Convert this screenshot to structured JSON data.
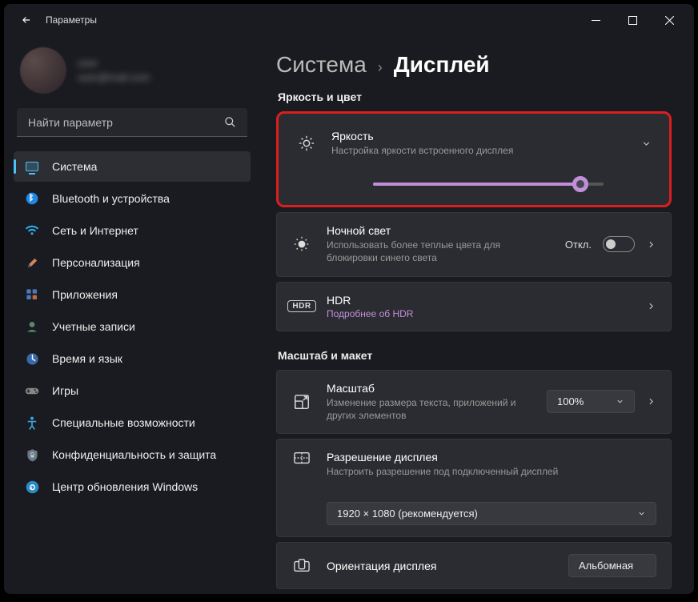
{
  "titlebar": {
    "title": "Параметры"
  },
  "profile": {
    "name": "user",
    "email": "user@mail.com"
  },
  "search": {
    "placeholder": "Найти параметр"
  },
  "sidebar": {
    "items": [
      {
        "label": "Система"
      },
      {
        "label": "Bluetooth и устройства"
      },
      {
        "label": "Сеть и Интернет"
      },
      {
        "label": "Персонализация"
      },
      {
        "label": "Приложения"
      },
      {
        "label": "Учетные записи"
      },
      {
        "label": "Время и язык"
      },
      {
        "label": "Игры"
      },
      {
        "label": "Специальные возможности"
      },
      {
        "label": "Конфиденциальность и защита"
      },
      {
        "label": "Центр обновления Windows"
      }
    ]
  },
  "breadcrumb": {
    "parent": "Система",
    "current": "Дисплей"
  },
  "sections": {
    "brightness_color": "Яркость и цвет",
    "scale_layout": "Масштаб и макет"
  },
  "brightness": {
    "title": "Яркость",
    "sub": "Настройка яркости встроенного дисплея",
    "value": 90
  },
  "night_light": {
    "title": "Ночной свет",
    "sub": "Использовать более теплые цвета для блокировки синего света",
    "state_label": "Откл."
  },
  "hdr": {
    "title": "HDR",
    "link": "Подробнее об HDR"
  },
  "scale": {
    "title": "Масштаб",
    "sub": "Изменение размера текста, приложений и других элементов",
    "value": "100%"
  },
  "resolution": {
    "title": "Разрешение дисплея",
    "sub": "Настроить разрешение под подключенный дисплей",
    "value": "1920 × 1080 (рекомендуется)"
  },
  "orientation": {
    "title": "Ориентация дисплея",
    "value": "Альбомная"
  }
}
